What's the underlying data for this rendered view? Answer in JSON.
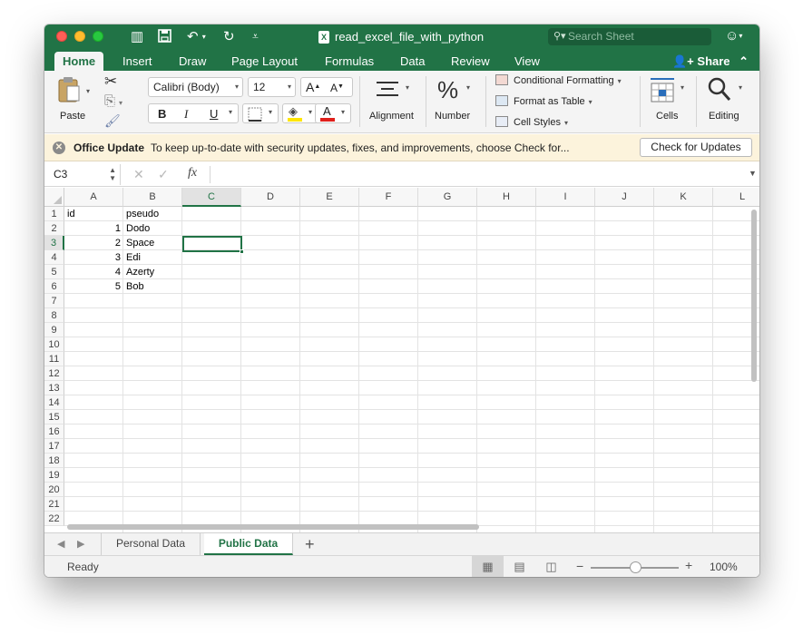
{
  "app": {
    "file_badge": "X",
    "window_title": "read_excel_file_with_python",
    "search_placeholder": "Search Sheet"
  },
  "tabs": [
    "Home",
    "Insert",
    "Draw",
    "Page Layout",
    "Formulas",
    "Data",
    "Review",
    "View"
  ],
  "share_label": "Share",
  "ribbon": {
    "paste_label": "Paste",
    "font_name": "Calibri (Body)",
    "font_size": "12",
    "grow_font": "A",
    "shrink_font": "A",
    "bold": "B",
    "italic": "I",
    "underline": "U",
    "font_color_glyph": "A",
    "alignment_label": "Alignment",
    "number_label": "Number",
    "number_glyph": "%",
    "conditional_formatting": "Conditional Formatting",
    "format_as_table": "Format as Table",
    "cell_styles": "Cell Styles",
    "cells_label": "Cells",
    "editing_label": "Editing"
  },
  "update_bar": {
    "title": "Office Update",
    "message": "To keep up-to-date with security updates, fixes, and improvements, choose Check for...",
    "button": "Check for Updates"
  },
  "formula_bar": {
    "name_box": "C3",
    "fx": "fx",
    "value": ""
  },
  "sheet": {
    "columns": [
      "A",
      "B",
      "C",
      "D",
      "E",
      "F",
      "G",
      "H",
      "I",
      "J",
      "K",
      "L"
    ],
    "rows": [
      "1",
      "2",
      "3",
      "4",
      "5",
      "6",
      "7",
      "8",
      "9",
      "10",
      "11",
      "12",
      "13",
      "14",
      "15",
      "16",
      "17",
      "18",
      "19",
      "20",
      "21",
      "22"
    ],
    "selected_column": "C",
    "selected_row": "3",
    "cells": {
      "A1": "id",
      "B1": "pseudo",
      "A2": "1",
      "B2": "Dodo",
      "A3": "2",
      "B3": "Space",
      "A4": "3",
      "B4": "Edi",
      "A5": "4",
      "B5": "Azerty",
      "A6": "5",
      "B6": "Bob"
    }
  },
  "sheet_tabs": [
    "Personal Data",
    "Public Data"
  ],
  "active_sheet": "Public Data",
  "status": {
    "text": "Ready",
    "zoom": "100%",
    "zoom_level_percent": 100
  },
  "colors": {
    "brand": "#217346",
    "update_bar": "#fcf3dc"
  }
}
